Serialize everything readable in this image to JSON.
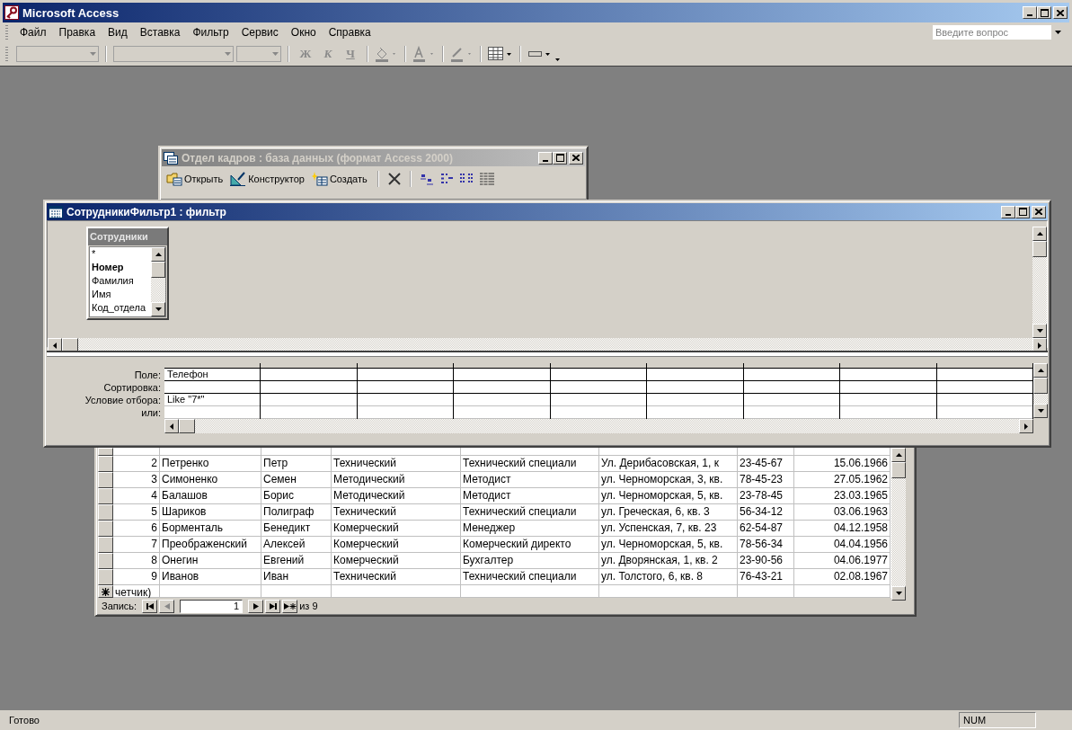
{
  "app": {
    "title": "Microsoft Access",
    "active": true
  },
  "menu": [
    {
      "label": "Файл"
    },
    {
      "label": "Правка"
    },
    {
      "label": "Вид"
    },
    {
      "label": "Вставка"
    },
    {
      "label": "Фильтр"
    },
    {
      "label": "Сервис"
    },
    {
      "label": "Окно"
    },
    {
      "label": "Справка"
    }
  ],
  "help_box": {
    "placeholder": "Введите вопрос"
  },
  "format_buttons": [
    {
      "label": "Ж",
      "disabled": true
    },
    {
      "label": "К",
      "disabled": true
    },
    {
      "label": "Ч",
      "disabled": true
    }
  ],
  "db_window": {
    "title": "Отдел кадров : база данных (формат Access 2000)",
    "active": false,
    "toolbar": [
      {
        "label": "Открыть"
      },
      {
        "label": "Конструктор"
      },
      {
        "label": "Создать"
      }
    ]
  },
  "datasheet": {
    "rows": [
      {
        "cells": [
          "2",
          "Петренко",
          "Петр",
          "Технический",
          "Технический специали",
          "Ул. Дерибасовская, 1, к",
          "23-45-67",
          "15.06.1966"
        ]
      },
      {
        "cells": [
          "3",
          "Симоненко",
          "Семен",
          "Методический",
          "Методист",
          "ул. Черноморская, 3, кв.",
          "78-45-23",
          "27.05.1962"
        ]
      },
      {
        "cells": [
          "4",
          "Балашов",
          "Борис",
          "Методический",
          "Методист",
          "ул. Черноморская, 5, кв.",
          "23-78-45",
          "23.03.1965"
        ]
      },
      {
        "cells": [
          "5",
          "Шариков",
          "Полиграф",
          "Технический",
          "Технический специали",
          "ул. Греческая, 6, кв. 3",
          "56-34-12",
          "03.06.1963"
        ]
      },
      {
        "cells": [
          "6",
          "Борменталь",
          "Бенедикт",
          "Комерческий",
          "Менеджер",
          "ул. Успенская, 7, кв. 23",
          "62-54-87",
          "04.12.1958"
        ]
      },
      {
        "cells": [
          "7",
          "Преображенский",
          "Алексей",
          "Комерческий",
          "Комерческий директо",
          "ул. Черноморская, 5, кв.",
          "78-56-34",
          "04.04.1956"
        ]
      },
      {
        "cells": [
          "8",
          "Онегин",
          "Евгений",
          "Комерческий",
          "Бухгалтер",
          "ул. Дворянская, 1, кв. 2",
          "23-90-56",
          "04.06.1977"
        ]
      },
      {
        "cells": [
          "9",
          "Иванов",
          "Иван",
          "Технический",
          "Технический специали",
          "ул. Толстого, 6, кв. 8",
          "76-43-21",
          "02.08.1967"
        ]
      }
    ],
    "new_row": "четчик)",
    "navigation": {
      "label": "Запись:",
      "current": "1",
      "total": "из 9"
    }
  },
  "filter_window": {
    "title": "СотрудникиФильтр1 : фильтр",
    "active": true,
    "field_list": {
      "title": "Сотрудники",
      "fields": [
        {
          "name": "*",
          "key": false
        },
        {
          "name": "Номер",
          "key": true
        },
        {
          "name": "Фамилия",
          "key": false
        },
        {
          "name": "Имя",
          "key": false
        },
        {
          "name": "Код_отдела",
          "key": false
        }
      ]
    },
    "row_labels": [
      "Поле:",
      "Сортировка:",
      "Условие отбора:",
      "или:"
    ],
    "columns": [
      {
        "field": "Телефон",
        "criteria": "Like \"7*\""
      }
    ]
  },
  "status_bar": {
    "text": "Готово",
    "indicators": [
      "NUM"
    ]
  }
}
